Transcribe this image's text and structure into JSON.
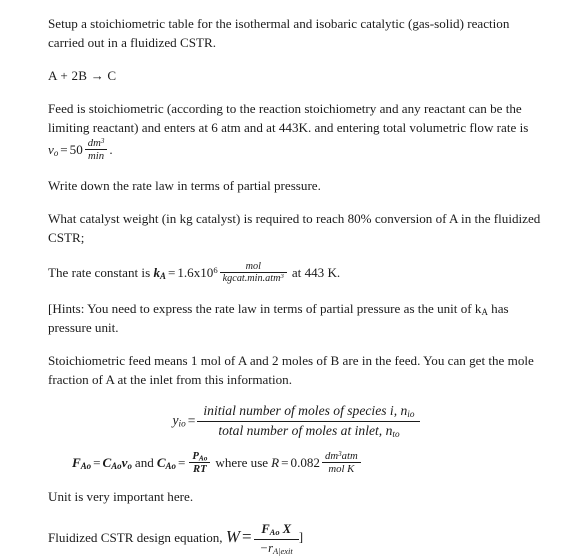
{
  "document": {
    "type": "chemical-reaction-engineering-problem",
    "paragraphs": {
      "p1": "Setup a stoichiometric table for the isothermal and isobaric catalytic (gas-solid) reaction carried out in a fluidized CSTR.",
      "reaction": "A + 2B → C",
      "p2_part1": "Feed is stoichiometric (according to the reaction stoichiometry and any reactant can be the limiting reactant) and enters at 6 atm and at 443K. and entering total volumetric flow rate is ",
      "p3": "Write down the rate law in terms of partial pressure.",
      "p4": "What catalyst weight (in kg catalyst) is required to reach 80% conversion of A in the fluidized CSTR;",
      "p5_prefix": "The rate constant is ",
      "p5_suffix": "at 443 K.",
      "p6": "[Hints: You need to express the rate law in terms of partial pressure as the unit of k",
      "p6_sub": "A",
      "p6_tail": " has pressure unit.",
      "p7": "Stoichiometric feed means 1 mol of A and 2 moles of B are in the feed. You can get the mole fraction of A at the inlet from this information.",
      "p8": "Unit is very important here.",
      "p9_prefix": "Fluidized CSTR design equation, "
    },
    "equations": {
      "flow_rate": {
        "symbol": "v",
        "symbol_sub": "o",
        "equals": "=",
        "value": "50",
        "unit_num": "dm",
        "unit_num_sup": "3",
        "unit_den": "min",
        "trailing": "."
      },
      "rate_constant": {
        "symbol": "k",
        "symbol_sub": "A",
        "equals": "=",
        "value": "1.6x10",
        "value_sup": "6",
        "unit_num": "mol",
        "unit_den": "kgcat.min.atm",
        "unit_den_sup": "3"
      },
      "mole_fraction": {
        "lhs": "y",
        "lhs_sub": "io",
        "equals": "=",
        "num_text": "initial number of moles of species i, n",
        "num_sub": "io",
        "den_text": "total number of moles at inlet, n",
        "den_sub": "to"
      },
      "molar_flow": {
        "f_sym": "F",
        "f_sub": "Ao",
        "eq1": "=",
        "c_sym": "C",
        "c_sub": "Ao",
        "v_sym": "v",
        "v_sub": "o",
        "and_text": "and",
        "c2_sym": "C",
        "c2_sub": "Ao",
        "eq2": "=",
        "frac_num": "P",
        "frac_num_sub": "Ao",
        "frac_den": "RT",
        "where_text": "where use",
        "r_sym": "R",
        "eq3": "=",
        "r_value": "0.082",
        "r_unit_num": "dm",
        "r_unit_num_sup": "3",
        "r_unit_num_tail": "atm",
        "r_unit_den": "mol K"
      },
      "design_equation": {
        "w_sym": "W",
        "equals": "=",
        "num_f": "F",
        "num_f_sub": "Ao",
        "num_x": "X",
        "den_minus": "−",
        "den_r": "r",
        "den_r_sub": "A|exit",
        "trailing_bracket": "]"
      }
    }
  },
  "colors": {
    "background": "#ffffff",
    "text": "#1b1b1b"
  }
}
